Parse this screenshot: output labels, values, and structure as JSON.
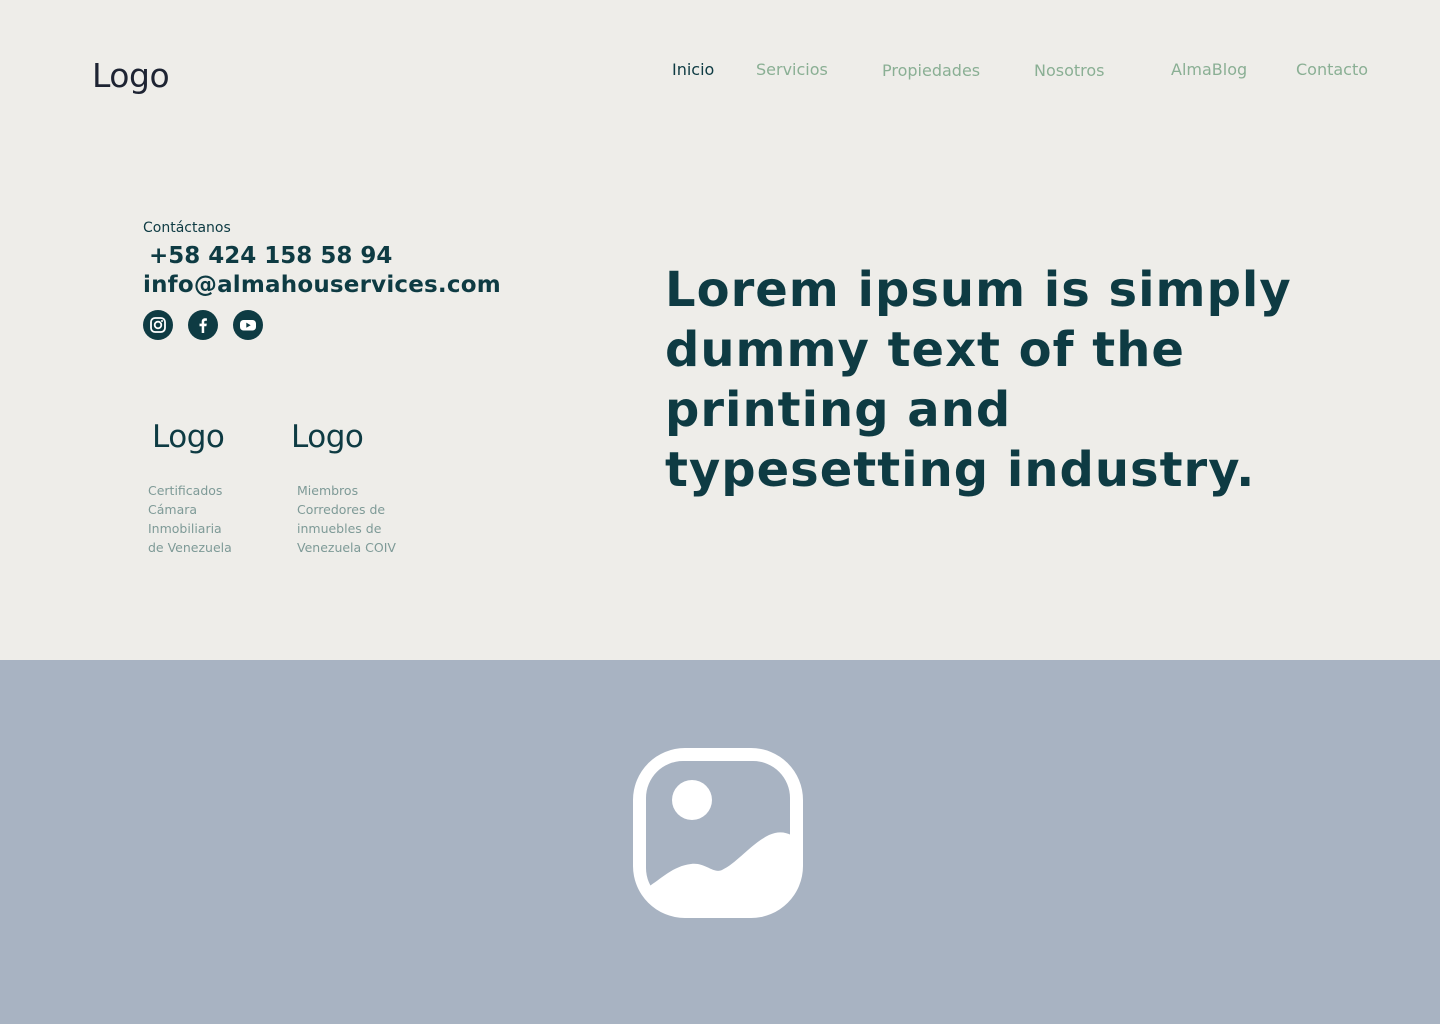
{
  "header": {
    "logo": "Logo",
    "nav": [
      {
        "label": "Inicio",
        "active": true
      },
      {
        "label": "Servicios",
        "active": false
      },
      {
        "label": "Propiedades",
        "active": false
      },
      {
        "label": "Nosotros",
        "active": false
      },
      {
        "label": "AlmaBlog",
        "active": false
      },
      {
        "label": "Contacto",
        "active": false
      }
    ]
  },
  "contact": {
    "label": "Contáctanos",
    "phone": "+58 424 158 58 94",
    "email": "info@almahouservices.com",
    "social": [
      "instagram-icon",
      "facebook-icon",
      "youtube-icon"
    ]
  },
  "partners": [
    {
      "logo": "Logo",
      "description": "Certificados\nCámara\nInmobiliaria\nde Venezuela"
    },
    {
      "logo": "Logo",
      "description": "Miembros\nCorredores de\ninmuebles de\nVenezuela COIV"
    }
  ],
  "hero": {
    "headline": "Lorem ipsum is simply dummy text of the printing and typesetting industry."
  },
  "media": {
    "placeholder_icon": "image-placeholder-icon"
  },
  "colors": {
    "background": "#EEEDE9",
    "primary": "#0E3B43",
    "nav_inactive": "#8AAF94",
    "muted_text": "#7E9A97",
    "image_band": "#A8B3C2"
  }
}
